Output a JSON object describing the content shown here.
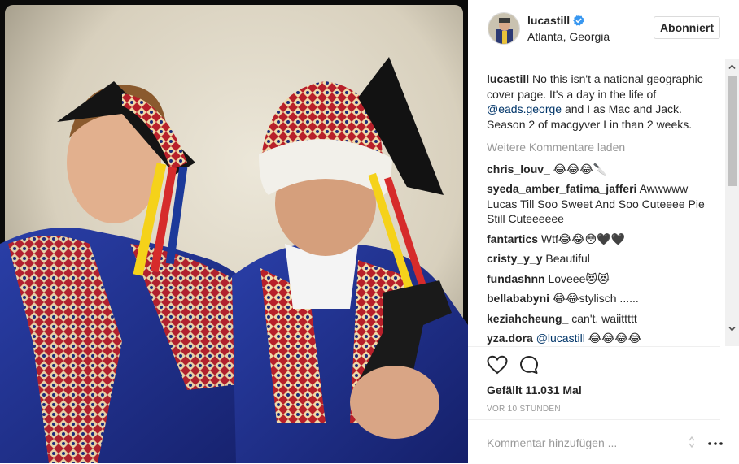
{
  "post": {
    "username": "lucastill",
    "location": "Atlanta, Georgia",
    "follow_label": "Abonniert",
    "caption": {
      "username": "lucastill",
      "text_before": "No this isn't a national geographic cover page. It's a day in the life of ",
      "mention": "@eads.george",
      "text_after": " and I as Mac and Jack. Season 2 of macgyver I in than 2 weeks."
    },
    "load_more": "Weitere Kommentare laden",
    "comments": [
      {
        "user": "chris_louv_",
        "mention": "",
        "text": "😂😂😂🔪"
      },
      {
        "user": "syeda_amber_fatima_jafferi",
        "mention": "",
        "text": "Awwwww Lucas Till Soo Sweet And Soo Cuteeee Pie Still Cuteeeeee"
      },
      {
        "user": "fantartics",
        "mention": "",
        "text": "Wtf😂😂😳🖤🖤"
      },
      {
        "user": "cristy_y_y",
        "mention": "",
        "text": "Beautiful"
      },
      {
        "user": "fundashnn",
        "mention": "",
        "text": "Loveee😻😻"
      },
      {
        "user": "bellababyni",
        "mention": "",
        "text": "😂😂stylisch ......"
      },
      {
        "user": "keziahcheung_",
        "mention": "",
        "text": "can't. waiittttt"
      },
      {
        "user": "yza.dora",
        "mention": "@lucastill",
        "text": " 😂😂😂😂"
      }
    ],
    "likes": "Gefällt 11.031 Mal",
    "time": "VOR 10 STUNDEN",
    "add_comment_placeholder": "Kommentar hinzufügen ...",
    "icons": {
      "like": "heart-icon",
      "comment": "comment-bubble-icon",
      "verified": "verified-badge-icon",
      "more": "more-options-icon"
    },
    "colors": {
      "mention": "#003569",
      "verified": "#3897f0",
      "muted": "#999999"
    }
  }
}
